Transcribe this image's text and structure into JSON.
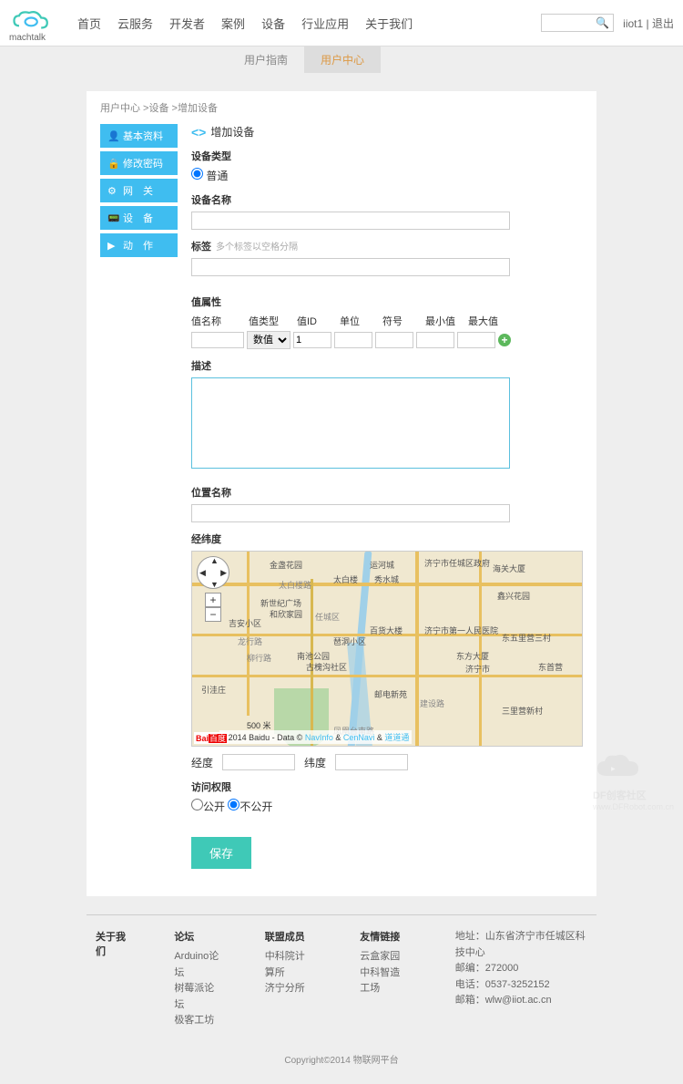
{
  "header": {
    "logo_text": "machtalk",
    "nav": [
      "首页",
      "云服务",
      "开发者",
      "案例",
      "设备",
      "行业应用",
      "关于我们"
    ],
    "user": "iiot1",
    "logout": "退出"
  },
  "subnav": {
    "guide": "用户指南",
    "center": "用户中心"
  },
  "breadcrumb": {
    "a": "用户中心",
    "b": "设备",
    "c": "增加设备"
  },
  "sidebar": {
    "items": [
      {
        "label": "基本资料"
      },
      {
        "label": "修改密码"
      },
      {
        "label": "网　关"
      },
      {
        "label": "设　备"
      },
      {
        "label": "动　作"
      }
    ]
  },
  "form": {
    "page_title": "增加设备",
    "type_label": "设备类型",
    "type_normal": "普通",
    "name_label": "设备名称",
    "name_value": "",
    "tag_label": "标签",
    "tag_hint": "多个标签以空格分隔",
    "tag_value": "",
    "attr_label": "值属性",
    "attr_headers": [
      "值名称",
      "值类型",
      "值ID",
      "单位",
      "符号",
      "最小值",
      "最大值"
    ],
    "attr_type_sel": "数值类",
    "attr_id": "1",
    "desc_label": "描述",
    "desc_value": "",
    "loc_label": "位置名称",
    "loc_value": "",
    "coord_label": "经纬度",
    "lng_label": "经度",
    "lat_label": "纬度",
    "lng_value": "",
    "lat_value": "",
    "access_label": "访问权限",
    "access_public": "公开",
    "access_private": "不公开",
    "save": "保存"
  },
  "map": {
    "scale": "500 米",
    "attr_prefix": "©2014 Baidu - Data ©",
    "attr_a": "NavInfo",
    "attr_amp": " & ",
    "attr_b": "CenNavi",
    "attr_amp2": " & ",
    "attr_c": "道道通",
    "labels": [
      "金盏花园",
      "运河城",
      "济宁市任城区政府",
      "海关大厦",
      "太白楼路",
      "太白楼",
      "秀水城",
      "鑫兴花园",
      "新世纪广场",
      "和欣家园",
      "任城区",
      "百货大楼",
      "济宁市第一人民医院",
      "吉安小区",
      "龙行路",
      "东五里营三村",
      "琶洞小区",
      "柳行路",
      "南池公园",
      "古槐沟社区",
      "济宁市",
      "东方大厦",
      "引洼庄",
      "建设路",
      "邮电新苑",
      "三里营新村",
      "东首营",
      "凤凰台南路"
    ]
  },
  "footer": {
    "about": "关于我们",
    "forum_h": "论坛",
    "forum": [
      "Arduino论坛",
      "树莓派论坛",
      "极客工坊"
    ],
    "member_h": "联盟成员",
    "member": [
      "中科院计算所",
      "济宁分所"
    ],
    "links_h": "友情链接",
    "links": [
      "云盒家园",
      "中科智造工场"
    ],
    "addr_l": "地址：",
    "addr": "山东省济宁市任城区科技中心",
    "zip_l": "邮编：",
    "zip": "272000",
    "tel_l": "电话：",
    "tel": "0537-3252152",
    "mail_l": "邮箱：",
    "mail": "wlw@iiot.ac.cn",
    "copyright": "Copyright©2014 物联网平台",
    "watermark": "DF创客社区",
    "watermark_url": "www.DFRobot.com.cn"
  }
}
